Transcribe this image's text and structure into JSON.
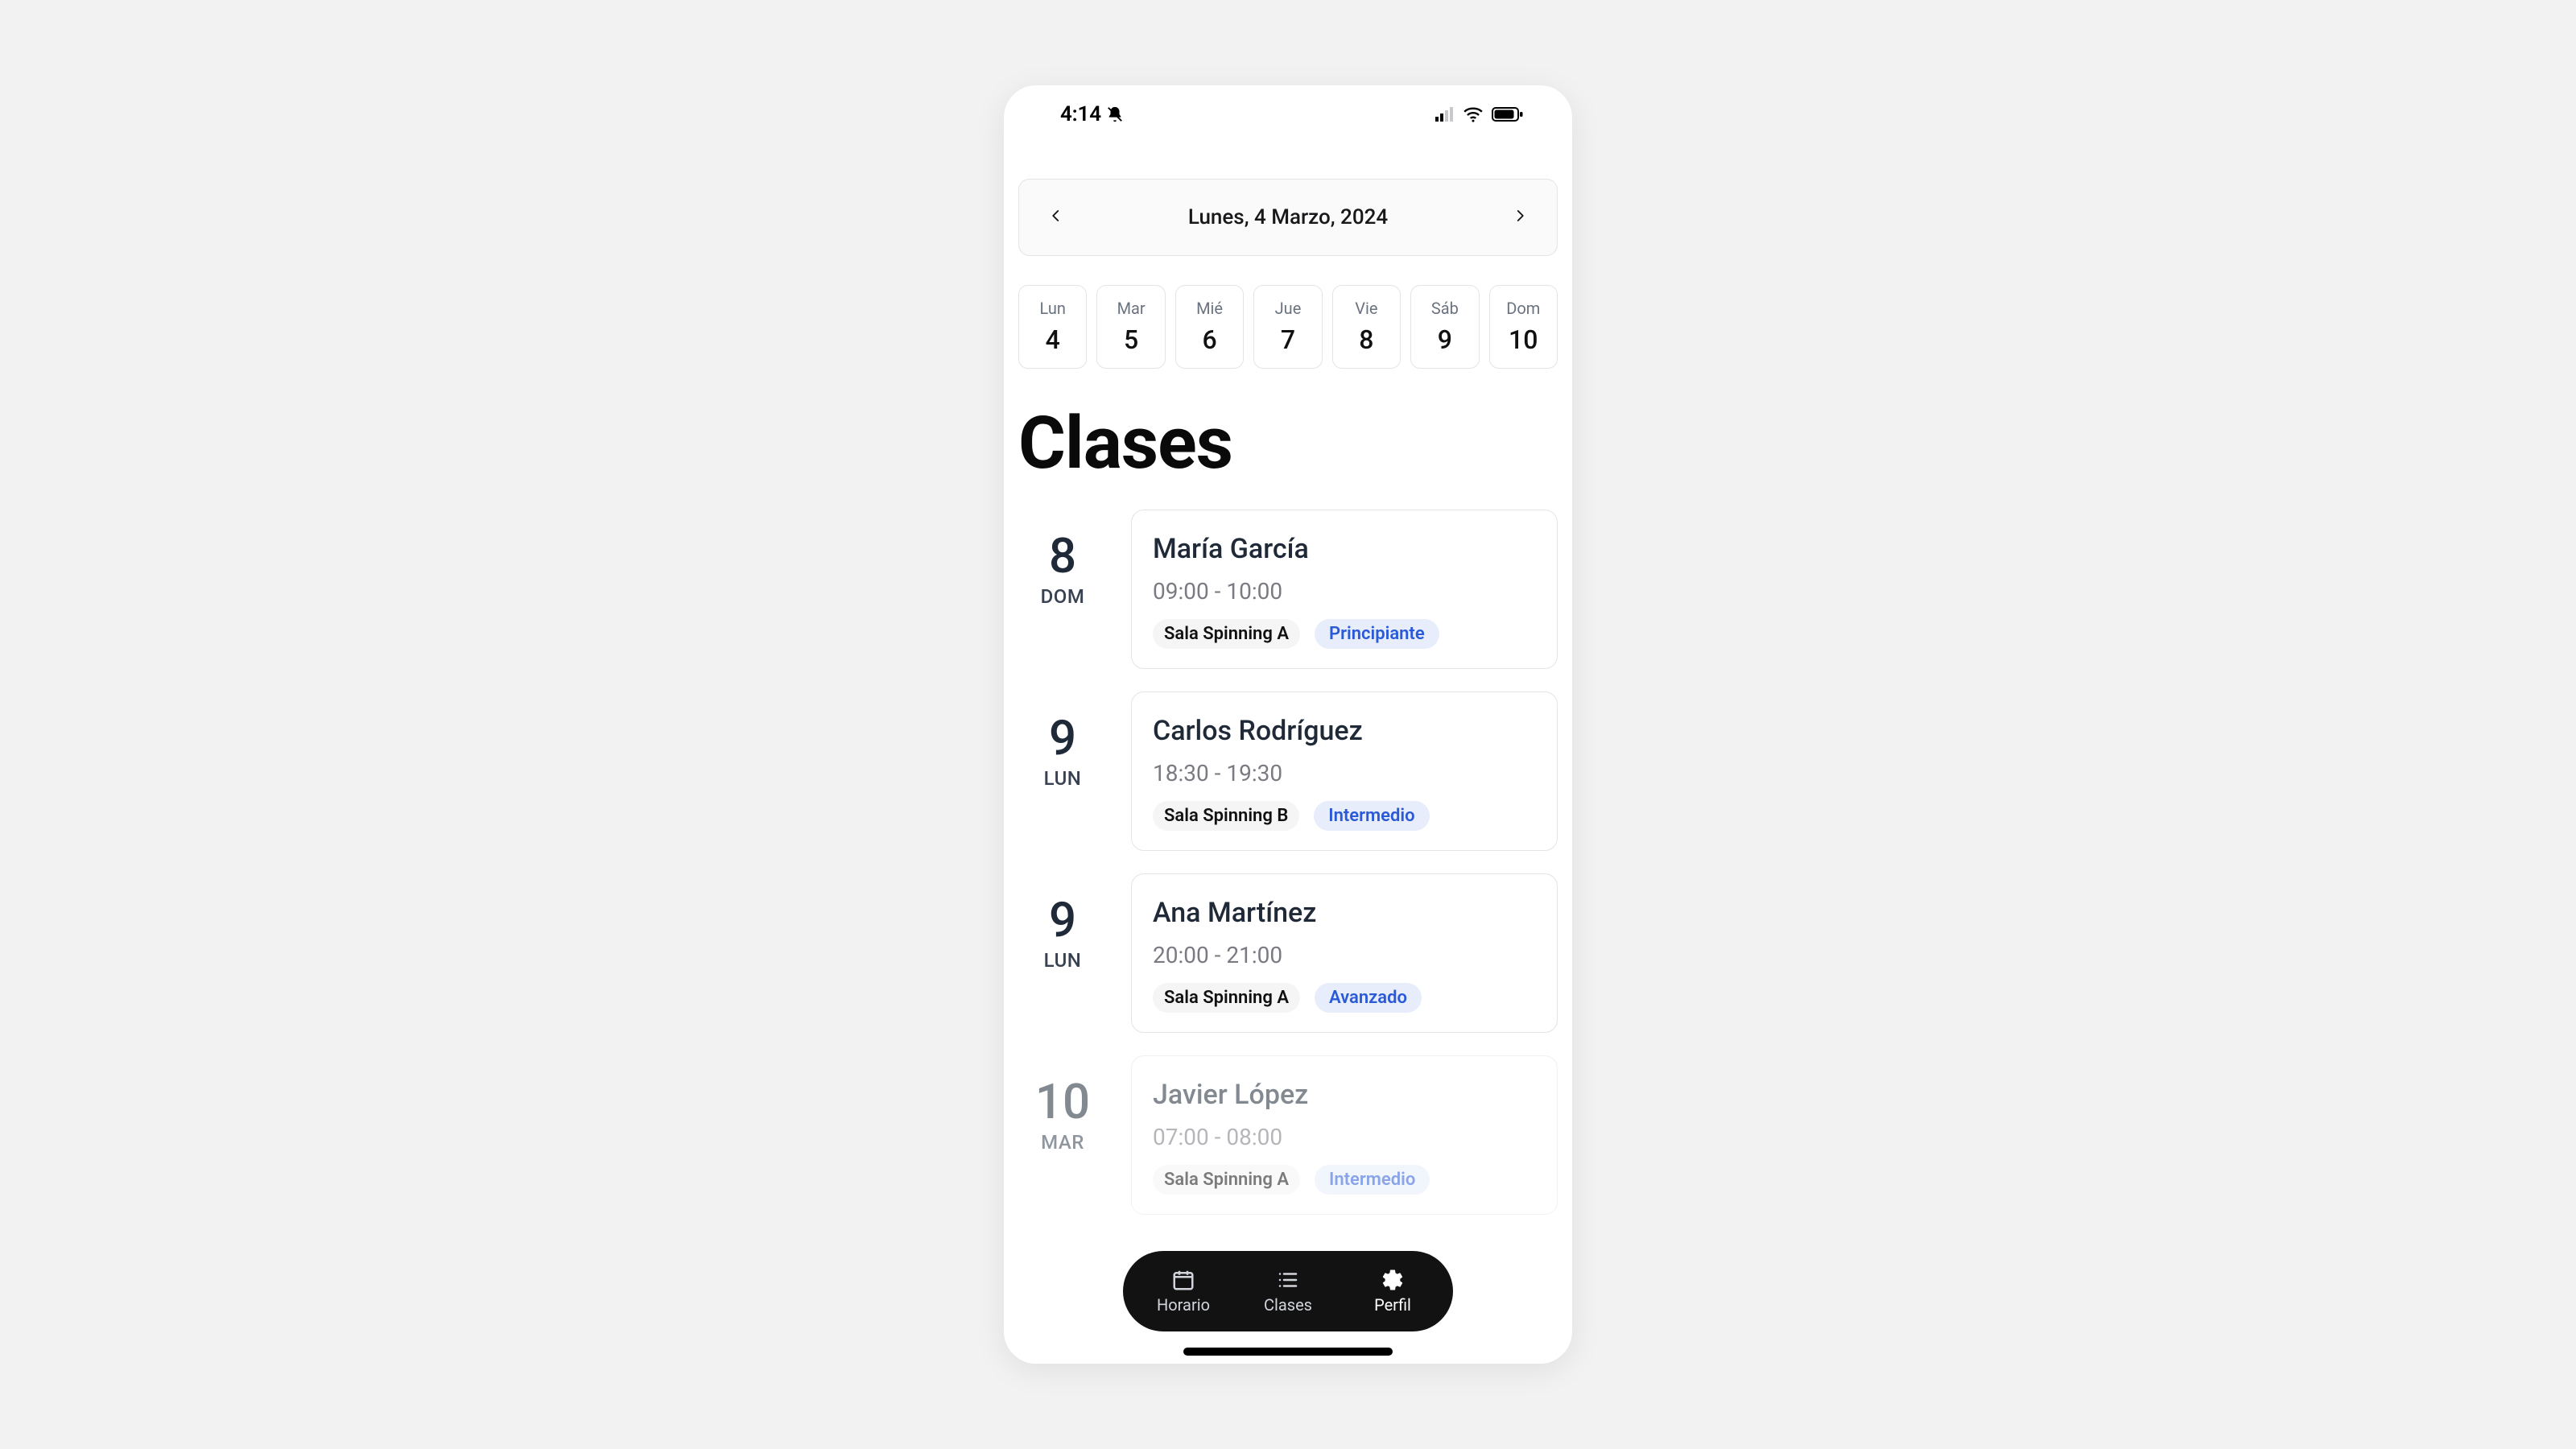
{
  "status": {
    "time": "4:14",
    "silent": true
  },
  "date_header": {
    "label": "Lunes, 4 Marzo, 2024"
  },
  "days": [
    {
      "dow": "Lun",
      "num": "4"
    },
    {
      "dow": "Mar",
      "num": "5"
    },
    {
      "dow": "Mié",
      "num": "6"
    },
    {
      "dow": "Jue",
      "num": "7"
    },
    {
      "dow": "Vie",
      "num": "8"
    },
    {
      "dow": "Sáb",
      "num": "9"
    },
    {
      "dow": "Dom",
      "num": "10"
    }
  ],
  "page_title": "Clases",
  "classes": [
    {
      "day_num": "8",
      "day_label": "DOM",
      "trainer": "María García",
      "time": "09:00 - 10:00",
      "room": "Sala Spinning A",
      "level": "Principiante"
    },
    {
      "day_num": "9",
      "day_label": "LUN",
      "trainer": "Carlos Rodríguez",
      "time": "18:30 - 19:30",
      "room": "Sala Spinning B",
      "level": "Intermedio"
    },
    {
      "day_num": "9",
      "day_label": "LUN",
      "trainer": "Ana Martínez",
      "time": "20:00 - 21:00",
      "room": "Sala Spinning A",
      "level": "Avanzado"
    },
    {
      "day_num": "10",
      "day_label": "MAR",
      "trainer": "Javier López",
      "time": "07:00 - 08:00",
      "room": "Sala Spinning A",
      "level": "Intermedio"
    }
  ],
  "nav": {
    "items": [
      {
        "label": "Horario",
        "icon": "calendar-icon"
      },
      {
        "label": "Clases",
        "icon": "list-icon"
      },
      {
        "label": "Perfil",
        "icon": "gear-icon"
      }
    ]
  }
}
